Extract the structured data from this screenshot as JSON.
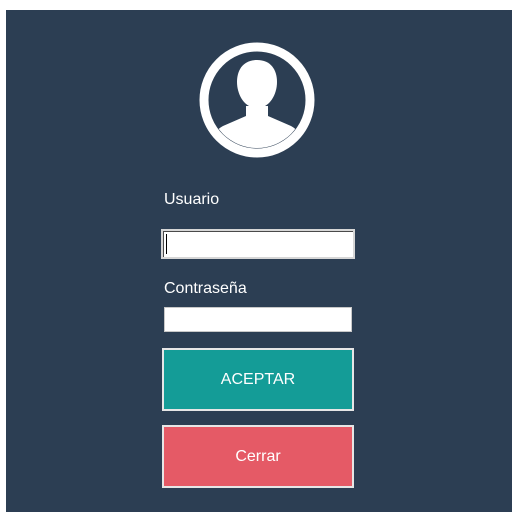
{
  "login": {
    "avatar_icon": "user-circle-icon",
    "username_label": "Usuario",
    "username_value": "",
    "password_label": "Contraseña",
    "password_value": "",
    "accept_label": "ACEPTAR",
    "close_label": "Cerrar"
  },
  "colors": {
    "panel_background": "#2c3e53",
    "accept_button": "#149c97",
    "close_button": "#e55a66",
    "text": "#ffffff"
  }
}
